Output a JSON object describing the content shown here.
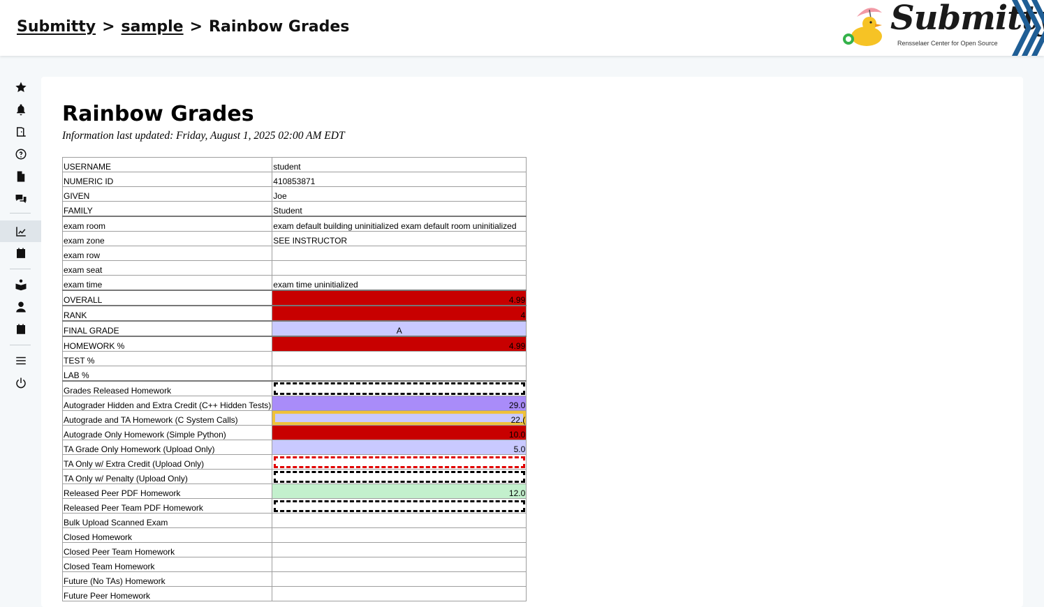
{
  "breadcrumb": {
    "items": [
      "Submitty",
      "sample",
      "Rainbow Grades"
    ],
    "separator": ">"
  },
  "logo": {
    "wordmark": "Submitty",
    "tagline": "Rensselaer Center for Open Source"
  },
  "sidebar": {
    "icons": [
      "star-icon",
      "bell-icon",
      "door-icon",
      "help-icon",
      "file-icon",
      "chat-icon",
      "chart-icon",
      "calendar-icon",
      "book-reader-icon",
      "user-icon",
      "calendar-icon",
      "menu-icon",
      "power-icon"
    ],
    "active_index": 6
  },
  "page": {
    "title": "Rainbow Grades",
    "updated": "Information last updated: Friday, August 1, 2025 02:00 AM EDT"
  },
  "table": {
    "rows": [
      {
        "label": "USERNAME",
        "value": "student"
      },
      {
        "label": "NUMERIC ID",
        "value": "410853871"
      },
      {
        "label": "GIVEN",
        "value": "Joe"
      },
      {
        "label": "FAMILY",
        "value": "Student"
      },
      {
        "label": "exam room",
        "value": "exam default building uninitialized exam default room uninitialized"
      },
      {
        "label": "exam zone",
        "value": "SEE INSTRUCTOR"
      },
      {
        "label": "exam row",
        "value": ""
      },
      {
        "label": "exam seat",
        "value": ""
      },
      {
        "label": "exam time",
        "value": "exam time uninitialized"
      },
      {
        "label": "OVERALL",
        "value": "4.99"
      },
      {
        "label": "RANK",
        "value": "4"
      },
      {
        "label": "FINAL GRADE",
        "value": "A"
      },
      {
        "label": "HOMEWORK %",
        "value": "4.99"
      },
      {
        "label": "TEST %",
        "value": ""
      },
      {
        "label": "LAB %",
        "value": ""
      },
      {
        "label": "Grades Released Homework",
        "value": ""
      },
      {
        "label": "Autograder Hidden and Extra Credit (C++ Hidden Tests)",
        "value": "29.0"
      },
      {
        "label": "Autograde and TA Homework (C System Calls)",
        "value": "22.("
      },
      {
        "label": "Autograde Only Homework (Simple Python)",
        "value": "10.0"
      },
      {
        "label": "TA Grade Only Homework (Upload Only)",
        "value": "5.0"
      },
      {
        "label": "TA Only w/ Extra Credit (Upload Only)",
        "value": ""
      },
      {
        "label": "TA Only w/ Penalty (Upload Only)",
        "value": ""
      },
      {
        "label": "Released Peer PDF Homework",
        "value": "12.0"
      },
      {
        "label": "Released Peer Team PDF Homework",
        "value": ""
      },
      {
        "label": "Bulk Upload Scanned Exam",
        "value": ""
      },
      {
        "label": "Closed Homework",
        "value": ""
      },
      {
        "label": "Closed Peer Team Homework",
        "value": ""
      },
      {
        "label": "Closed Team Homework",
        "value": ""
      },
      {
        "label": "Future (No TAs) Homework",
        "value": ""
      },
      {
        "label": "Future Peer Homework",
        "value": ""
      }
    ]
  },
  "colors": {
    "red": "#c80000",
    "lavender": "#c9c9ff",
    "purple": "#a98cf9",
    "green": "#c3f0cd",
    "gold": "#efc13a"
  }
}
